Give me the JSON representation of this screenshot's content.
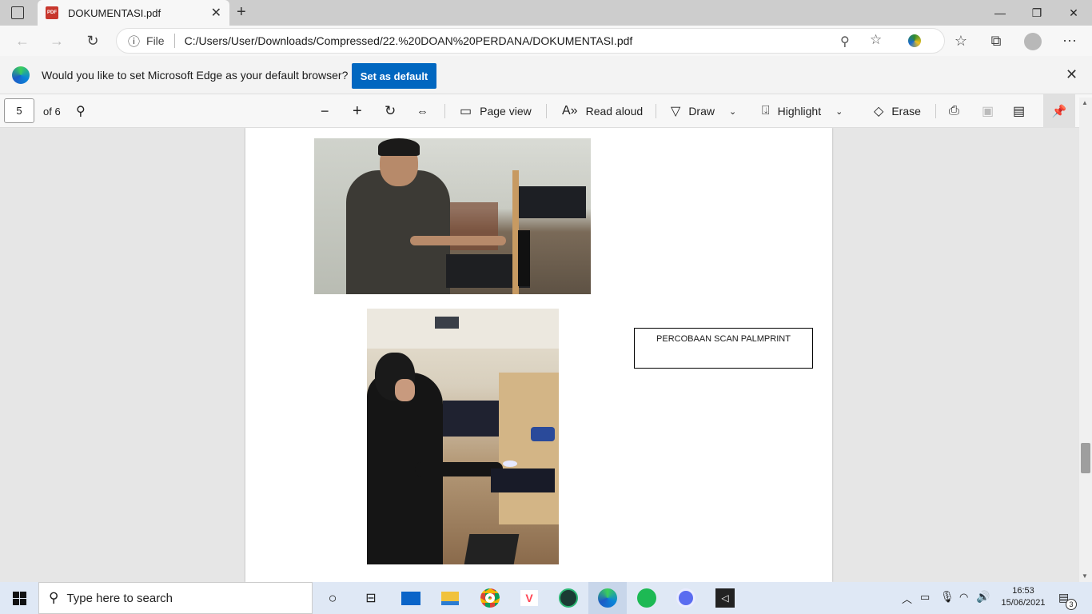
{
  "tab": {
    "title": "DOKUMENTASI.pdf"
  },
  "address": {
    "scheme_label": "File",
    "url": "C:/Users/User/Downloads/Compressed/22.%20DOAN%20PERDANA/DOKUMENTASI.pdf"
  },
  "infobar": {
    "message": "Would you like to set Microsoft Edge as your default browser?",
    "button": "Set as default"
  },
  "pdf_toolbar": {
    "page_current": "5",
    "page_total": "of 6",
    "page_view": "Page view",
    "read_aloud": "Read aloud",
    "draw": "Draw",
    "highlight": "Highlight",
    "erase": "Erase"
  },
  "document": {
    "caption": "PERCOBAAN SCAN PALMPRINT"
  },
  "taskbar": {
    "search_placeholder": "Type here to search",
    "time": "16:53",
    "date": "15/06/2021",
    "notifications": "3"
  },
  "colors": {
    "accent": "#0067c0",
    "pdf_icon": "#c8372d",
    "taskbar": "#dfe8f5"
  }
}
